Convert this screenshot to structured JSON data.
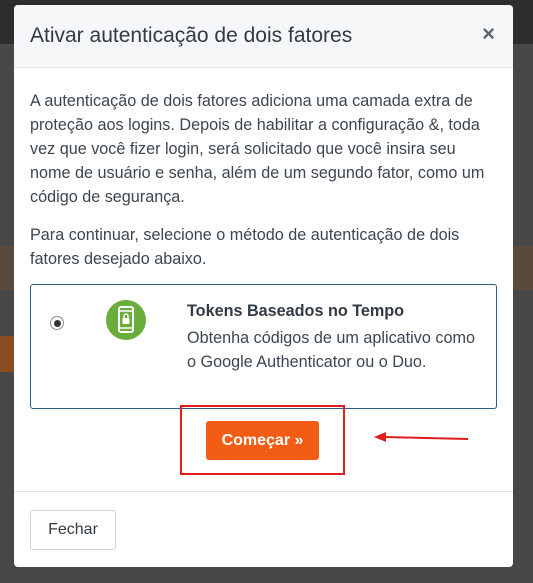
{
  "modal": {
    "title": "Ativar autenticação de dois fatores",
    "close_symbol": "×",
    "intro": "A autenticação de dois fatores adiciona uma camada extra de proteção aos logins. Depois de habilitar a configuração &, toda vez que você fizer login, será solicitado que você insira seu nome de usuário e senha, além de um segundo fator, como um código de segurança.",
    "instruction": "Para continuar, selecione o método de autenticação de dois fatores desejado abaixo.",
    "option": {
      "title": "Tokens Baseados no Tempo",
      "description": "Obtenha códigos de um aplicativo como o Google Authenticator ou o Duo.",
      "selected": true,
      "icon": "phone-lock-icon"
    },
    "start_button": "Começar »",
    "close_button": "Fechar"
  },
  "colors": {
    "accent": "#f35c14",
    "annotation": "#e01e1e",
    "option_border": "#2f5d89",
    "icon_green": "#6aad3d"
  }
}
